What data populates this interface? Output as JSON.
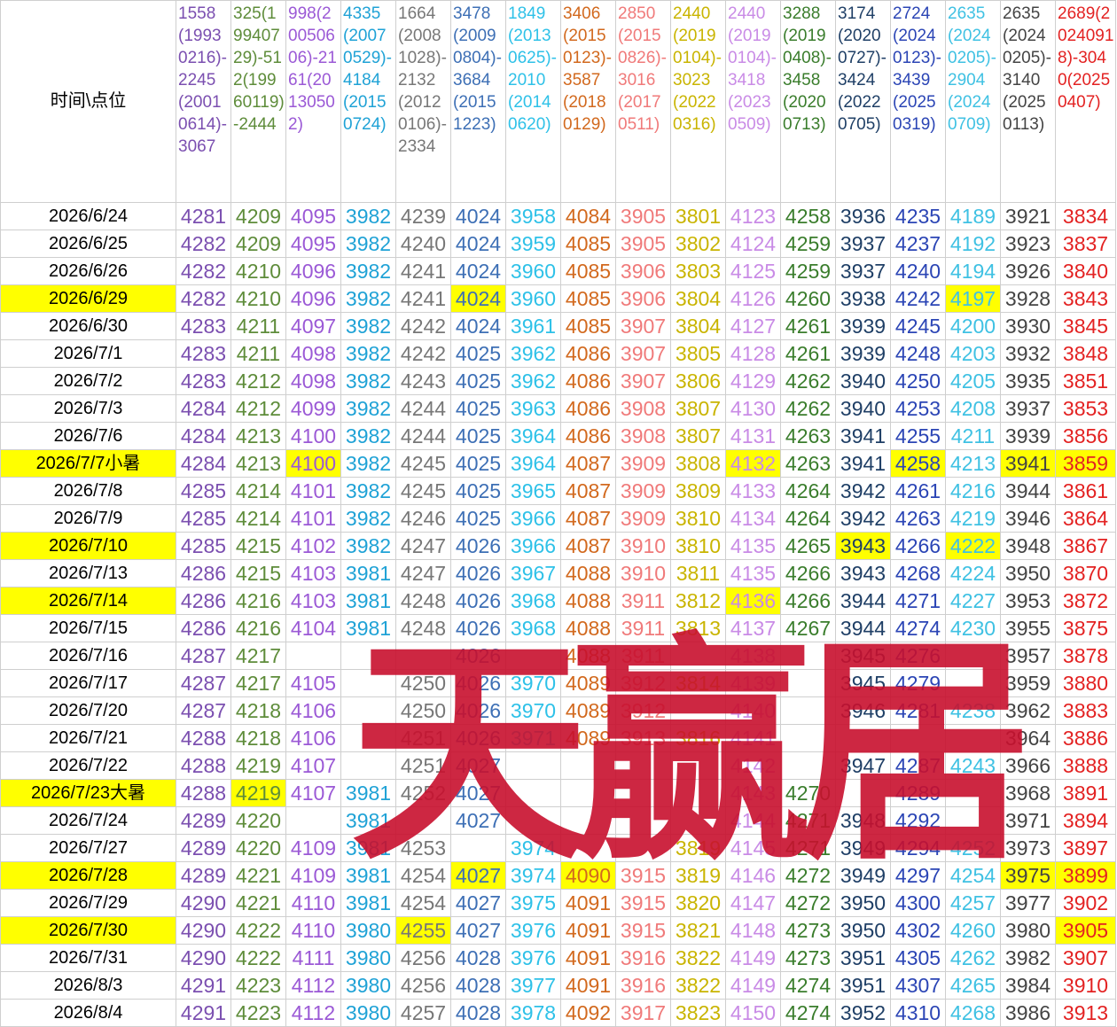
{
  "corner_label": "时间\\点位",
  "watermark": "天赢居",
  "columns": [
    {
      "header": "1558(19930216)-2245(20010614)-3067",
      "color": "#7b4fb0"
    },
    {
      "header": "325(19940729)-512(19960119)-2444",
      "color": "#5e8c3a"
    },
    {
      "header": "998(200506 06)-2161(20130502)",
      "color": "#9b59d6"
    },
    {
      "header": "4335(20070529)-4184(20150724)",
      "color": "#1fa2d6"
    },
    {
      "header": "1664(20081028)-2132(20120106)-2334",
      "color": "#777777"
    },
    {
      "header": "3478(20090804)-3684(20151223)",
      "color": "#3d6fb5"
    },
    {
      "header": "1849(20130625)-2010(20140620)",
      "color": "#2ec1e8"
    },
    {
      "header": "3406(20150123)-3587(20180129)",
      "color": "#d2691e"
    },
    {
      "header": "2850(20150826)-3016(20170511)",
      "color": "#f07a7a"
    },
    {
      "header": "2440(20190104)-3023(20220316)",
      "color": "#c9b400"
    },
    {
      "header": "2440(20190104)-3418(20230509)",
      "color": "#c98be6"
    },
    {
      "header": "3288(20190408)-3458(20200713)",
      "color": "#3a7d2c"
    },
    {
      "header": "3174(20200727)-3424(20220705)",
      "color": "#1f3f66"
    },
    {
      "header": "2724(20240123)-3439(20250319)",
      "color": "#2b45b5"
    },
    {
      "header": "2635(20240205)-2904(20240709)",
      "color": "#3fc1e3"
    },
    {
      "header": "2635(20240205)-3140(20250113)",
      "color": "#444444"
    },
    {
      "header": "2689(20240918)-3040(20250407)",
      "color": "#e32222"
    }
  ],
  "rows": [
    {
      "date": "2026/6/24",
      "hl": [],
      "values": [
        "4281",
        "4209",
        "4095",
        "3982",
        "4239",
        "4024",
        "3958",
        "4084",
        "3905",
        "3801",
        "4123",
        "4258",
        "3936",
        "4235",
        "4189",
        "3921",
        "3834"
      ]
    },
    {
      "date": "2026/6/25",
      "hl": [],
      "values": [
        "4282",
        "4209",
        "4095",
        "3982",
        "4240",
        "4024",
        "3959",
        "4085",
        "3905",
        "3802",
        "4124",
        "4259",
        "3937",
        "4237",
        "4192",
        "3923",
        "3837"
      ]
    },
    {
      "date": "2026/6/26",
      "hl": [],
      "values": [
        "4282",
        "4210",
        "4096",
        "3982",
        "4241",
        "4024",
        "3960",
        "4085",
        "3906",
        "3803",
        "4125",
        "4259",
        "3937",
        "4240",
        "4194",
        "3926",
        "3840"
      ]
    },
    {
      "date": "2026/6/29",
      "hl": [
        0,
        5,
        14
      ],
      "values": [
        "4282",
        "4210",
        "4096",
        "3982",
        "4241",
        "4024",
        "3960",
        "4085",
        "3906",
        "3804",
        "4126",
        "4260",
        "3938",
        "4242",
        "4197",
        "3928",
        "3843"
      ]
    },
    {
      "date": "2026/6/30",
      "hl": [],
      "values": [
        "4283",
        "4211",
        "4097",
        "3982",
        "4242",
        "4024",
        "3961",
        "4085",
        "3907",
        "3804",
        "4127",
        "4261",
        "3939",
        "4245",
        "4200",
        "3930",
        "3845"
      ]
    },
    {
      "date": "2026/7/1",
      "hl": [],
      "values": [
        "4283",
        "4211",
        "4098",
        "3982",
        "4242",
        "4025",
        "3962",
        "4086",
        "3907",
        "3805",
        "4128",
        "4261",
        "3939",
        "4248",
        "4203",
        "3932",
        "3848"
      ]
    },
    {
      "date": "2026/7/2",
      "hl": [],
      "values": [
        "4283",
        "4212",
        "4098",
        "3982",
        "4243",
        "4025",
        "3962",
        "4086",
        "3907",
        "3806",
        "4129",
        "4262",
        "3940",
        "4250",
        "4205",
        "3935",
        "3851"
      ]
    },
    {
      "date": "2026/7/3",
      "hl": [],
      "values": [
        "4284",
        "4212",
        "4099",
        "3982",
        "4244",
        "4025",
        "3963",
        "4086",
        "3908",
        "3807",
        "4130",
        "4262",
        "3940",
        "4253",
        "4208",
        "3937",
        "3853"
      ]
    },
    {
      "date": "2026/7/6",
      "hl": [],
      "values": [
        "4284",
        "4213",
        "4100",
        "3982",
        "4244",
        "4025",
        "3964",
        "4086",
        "3908",
        "3807",
        "4131",
        "4263",
        "3941",
        "4255",
        "4211",
        "3939",
        "3856"
      ]
    },
    {
      "date": "2026/7/7小暑",
      "hl": [
        0,
        2,
        10,
        13,
        15,
        16
      ],
      "values": [
        "4284",
        "4213",
        "4100",
        "3982",
        "4245",
        "4025",
        "3964",
        "4087",
        "3909",
        "3808",
        "4132",
        "4263",
        "3941",
        "4258",
        "4213",
        "3941",
        "3859"
      ]
    },
    {
      "date": "2026/7/8",
      "hl": [],
      "values": [
        "4285",
        "4214",
        "4101",
        "3982",
        "4245",
        "4025",
        "3965",
        "4087",
        "3909",
        "3809",
        "4133",
        "4264",
        "3942",
        "4261",
        "4216",
        "3944",
        "3861"
      ]
    },
    {
      "date": "2026/7/9",
      "hl": [],
      "values": [
        "4285",
        "4214",
        "4101",
        "3982",
        "4246",
        "4025",
        "3966",
        "4087",
        "3909",
        "3810",
        "4134",
        "4264",
        "3942",
        "4263",
        "4219",
        "3946",
        "3864"
      ]
    },
    {
      "date": "2026/7/10",
      "hl": [
        0,
        12,
        14
      ],
      "values": [
        "4285",
        "4215",
        "4102",
        "3982",
        "4247",
        "4026",
        "3966",
        "4087",
        "3910",
        "3810",
        "4135",
        "4265",
        "3943",
        "4266",
        "4222",
        "3948",
        "3867"
      ]
    },
    {
      "date": "2026/7/13",
      "hl": [],
      "values": [
        "4286",
        "4215",
        "4103",
        "3981",
        "4247",
        "4026",
        "3967",
        "4088",
        "3910",
        "3811",
        "4135",
        "4266",
        "3943",
        "4268",
        "4224",
        "3950",
        "3870"
      ]
    },
    {
      "date": "2026/7/14",
      "hl": [
        0,
        10
      ],
      "values": [
        "4286",
        "4216",
        "4103",
        "3981",
        "4248",
        "4026",
        "3968",
        "4088",
        "3911",
        "3812",
        "4136",
        "4266",
        "3944",
        "4271",
        "4227",
        "3953",
        "3872"
      ]
    },
    {
      "date": "2026/7/15",
      "hl": [],
      "values": [
        "4286",
        "4216",
        "4104",
        "3981",
        "4248",
        "4026",
        "3968",
        "4088",
        "3911",
        "3813",
        "4137",
        "4267",
        "3944",
        "4274",
        "4230",
        "3955",
        "3875"
      ]
    },
    {
      "date": "2026/7/16",
      "hl": [],
      "values": [
        "4287",
        "4217",
        "",
        "",
        "",
        "4026",
        "",
        "4088",
        "3911",
        "",
        "4138",
        "",
        "3945",
        "4276",
        "",
        "3957",
        "3878"
      ]
    },
    {
      "date": "2026/7/17",
      "hl": [],
      "values": [
        "4287",
        "4217",
        "4105",
        "",
        "4250",
        "4026",
        "3970",
        "4089",
        "3912",
        "3814",
        "4139",
        "",
        "3945",
        "4279",
        "",
        "3959",
        "3880"
      ]
    },
    {
      "date": "2026/7/20",
      "hl": [],
      "values": [
        "4287",
        "4218",
        "4106",
        "",
        "4250",
        "4026",
        "3970",
        "4089",
        "3912",
        "",
        "4140",
        "",
        "3946",
        "4281",
        "4238",
        "3962",
        "3883"
      ]
    },
    {
      "date": "2026/7/21",
      "hl": [],
      "values": [
        "4288",
        "4218",
        "4106",
        "",
        "4251",
        "4026",
        "3971",
        "4089",
        "3913",
        "3816",
        "4141",
        "",
        "",
        "",
        "",
        "3964",
        "3886"
      ]
    },
    {
      "date": "2026/7/22",
      "hl": [],
      "values": [
        "4288",
        "4219",
        "4107",
        "",
        "4251",
        "4027",
        "",
        "",
        "",
        "",
        "4142",
        "",
        "3947",
        "4287",
        "4243",
        "3966",
        "3888"
      ]
    },
    {
      "date": "2026/7/23大暑",
      "hl": [
        0,
        1
      ],
      "values": [
        "4288",
        "4219",
        "4107",
        "3981",
        "4252",
        "4027",
        "",
        "",
        "",
        "",
        "4143",
        "4270",
        "",
        "4289",
        "",
        "3968",
        "3891"
      ]
    },
    {
      "date": "2026/7/24",
      "hl": [],
      "values": [
        "4289",
        "4220",
        "",
        "3981",
        "",
        "4027",
        "",
        "",
        "",
        "",
        "4144",
        "4271",
        "3948",
        "4292",
        "",
        "3971",
        "3894"
      ]
    },
    {
      "date": "2026/7/27",
      "hl": [],
      "values": [
        "4289",
        "4220",
        "4109",
        "3981",
        "4253",
        "",
        "3974",
        "",
        "",
        "3819",
        "4145",
        "4271",
        "3949",
        "4294",
        "4252",
        "3973",
        "3897"
      ]
    },
    {
      "date": "2026/7/28",
      "hl": [
        0,
        5,
        7,
        15,
        16
      ],
      "values": [
        "4289",
        "4221",
        "4109",
        "3981",
        "4254",
        "4027",
        "3974",
        "4090",
        "3915",
        "3819",
        "4146",
        "4272",
        "3949",
        "4297",
        "4254",
        "3975",
        "3899"
      ]
    },
    {
      "date": "2026/7/29",
      "hl": [],
      "values": [
        "4290",
        "4221",
        "4110",
        "3981",
        "4254",
        "4027",
        "3975",
        "4091",
        "3915",
        "3820",
        "4147",
        "4272",
        "3950",
        "4300",
        "4257",
        "3977",
        "3902"
      ]
    },
    {
      "date": "2026/7/30",
      "hl": [
        0,
        4,
        16
      ],
      "values": [
        "4290",
        "4222",
        "4110",
        "3980",
        "4255",
        "4027",
        "3976",
        "4091",
        "3915",
        "3821",
        "4148",
        "4273",
        "3950",
        "4302",
        "4260",
        "3980",
        "3905"
      ]
    },
    {
      "date": "2026/7/31",
      "hl": [],
      "values": [
        "4290",
        "4222",
        "4111",
        "3980",
        "4256",
        "4028",
        "3976",
        "4091",
        "3916",
        "3822",
        "4149",
        "4273",
        "3951",
        "4305",
        "4262",
        "3982",
        "3907"
      ]
    },
    {
      "date": "2026/8/3",
      "hl": [],
      "values": [
        "4291",
        "4223",
        "4112",
        "3980",
        "4256",
        "4028",
        "3977",
        "4091",
        "3916",
        "3822",
        "4149",
        "4274",
        "3951",
        "4307",
        "4265",
        "3984",
        "3910"
      ]
    },
    {
      "date": "2026/8/4",
      "hl": [],
      "values": [
        "4291",
        "4223",
        "4112",
        "3980",
        "4257",
        "4028",
        "3978",
        "4092",
        "3917",
        "3823",
        "4150",
        "4274",
        "3952",
        "4310",
        "4268",
        "3986",
        "3913"
      ]
    }
  ]
}
